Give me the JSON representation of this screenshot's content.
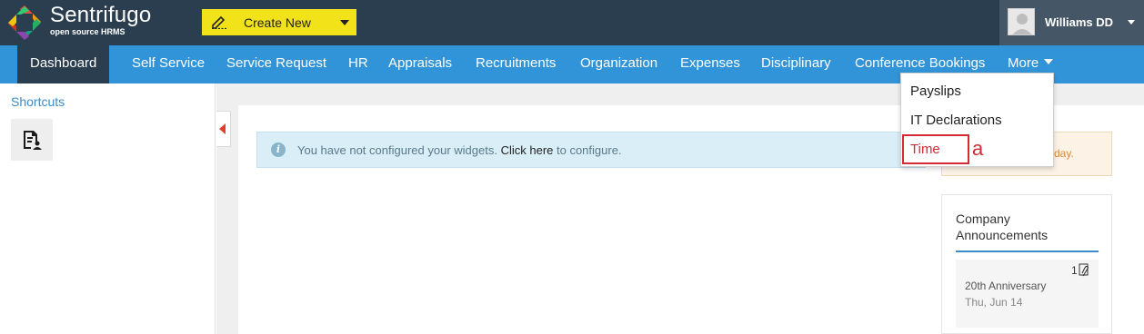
{
  "header": {
    "brand": "Sentrifugo",
    "brand_sub": "open source HRMS",
    "create_new_label": "Create New",
    "user_name": "Williams DD"
  },
  "nav": {
    "items": [
      "Dashboard",
      "Self Service",
      "Service Request",
      "HR",
      "Appraisals",
      "Recruitments",
      "Organization",
      "Expenses",
      "Disciplinary",
      "Conference Bookings",
      "More"
    ],
    "active": "Dashboard"
  },
  "more_menu": {
    "items": [
      "Payslips",
      "IT Declarations",
      "Time"
    ],
    "highlighted": "Time",
    "annotation": "a"
  },
  "shortcuts": {
    "title": "Shortcuts"
  },
  "alert": {
    "text_before": "You have not configured your widgets.",
    "link": "Click here",
    "text_after": "to configure."
  },
  "notice": {
    "partial_text": "day."
  },
  "announcements": {
    "title": "Company Announcements",
    "count": "1",
    "item_name": "20th Anniversary",
    "item_date": "Thu, Jun 14"
  },
  "colors": {
    "header_bg": "#2b3e50",
    "nav_bg": "#3294d8",
    "create_btn": "#f2e21a",
    "highlight_red": "#d32a36"
  }
}
